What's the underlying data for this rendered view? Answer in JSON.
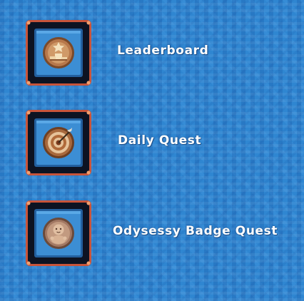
{
  "menu": {
    "items": [
      {
        "label": "Leaderboard",
        "icon": "leaderboard-podium-icon"
      },
      {
        "label": "Daily Quest",
        "icon": "target-dartboard-icon"
      },
      {
        "label": "Odysessy Badge Quest",
        "icon": "baby-badge-icon"
      }
    ]
  },
  "colors": {
    "background": "#2f86d1",
    "frame_outer": "#c8543a",
    "frame_dark": "#0d1322",
    "tile_blue": "#3c8ed4",
    "coin_bronze": "#b7784b",
    "label_text": "#ffffff"
  }
}
